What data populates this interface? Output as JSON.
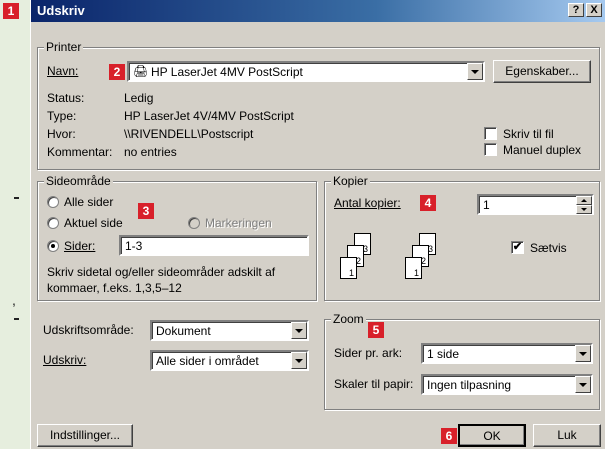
{
  "dialog": {
    "title": "Udskriv",
    "help_button": "?",
    "close_button": "X"
  },
  "badges": [
    "1",
    "2",
    "3",
    "4",
    "5",
    "6"
  ],
  "printer": {
    "group_label": "Printer",
    "name_label": "Navn:",
    "name_value": "HP LaserJet 4MV PostScript",
    "properties_button": "Egenskaber...",
    "status_label": "Status:",
    "status_value": "Ledig",
    "type_label": "Type:",
    "type_value": "HP LaserJet 4V/4MV PostScript",
    "where_label": "Hvor:",
    "where_value": "\\\\RIVENDELL\\Postscript",
    "comment_label": "Kommentar:",
    "comment_value": "no entries",
    "print_to_file_label": "Skriv til fil",
    "manual_duplex_label": "Manuel duplex"
  },
  "page_range": {
    "group_label": "Sideområde",
    "all_label": "Alle sider",
    "current_label": "Aktuel side",
    "selection_label": "Markeringen",
    "pages_label": "Sider:",
    "pages_value": "1-3",
    "hint_line1": "Skriv sidetal og/eller sideområder adskilt af",
    "hint_line2": "kommaer, f.eks. 1,3,5–12"
  },
  "copies": {
    "group_label": "Kopier",
    "count_label": "Antal kopier:",
    "count_value": "1",
    "collate_label": "Sætvis",
    "collate_checked": true,
    "sheet_numbers": [
      "3",
      "2",
      "1"
    ]
  },
  "print_what": {
    "label": "Udskriftsområde:",
    "value": "Dokument"
  },
  "print": {
    "label": "Udskriv:",
    "value": "Alle sider i området"
  },
  "zoom": {
    "group_label": "Zoom",
    "pages_per_sheet_label": "Sider pr. ark:",
    "pages_per_sheet_value": "1 side",
    "scale_label": "Skaler til papir:",
    "scale_value": "Ingen tilpasning"
  },
  "footer": {
    "options_button": "Indstillinger...",
    "ok_button": "OK",
    "cancel_button": "Luk"
  },
  "side_text": {
    "comma": ","
  }
}
